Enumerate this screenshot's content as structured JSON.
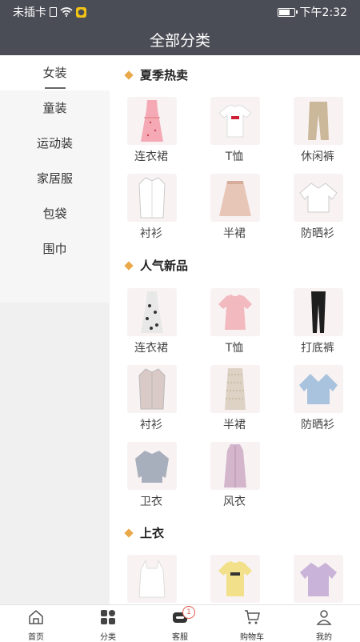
{
  "status": {
    "carrier": "未插卡",
    "time": "下午2:32"
  },
  "header": {
    "title": "全部分类"
  },
  "sidebar": {
    "items": [
      {
        "label": "女装",
        "active": true
      },
      {
        "label": "童装"
      },
      {
        "label": "运动装"
      },
      {
        "label": "家居服"
      },
      {
        "label": "包袋"
      },
      {
        "label": "围巾"
      }
    ]
  },
  "sections": [
    {
      "title": "夏季热卖",
      "items": [
        {
          "label": "连衣裙",
          "icon": "dress-icon"
        },
        {
          "label": "T恤",
          "icon": "tshirt-icon"
        },
        {
          "label": "休闲裤",
          "icon": "pants-icon"
        },
        {
          "label": "衬衫",
          "icon": "shirt-icon"
        },
        {
          "label": "半裙",
          "icon": "skirt-icon"
        },
        {
          "label": "防晒衫",
          "icon": "cardigan-icon"
        }
      ]
    },
    {
      "title": "人气新品",
      "items": [
        {
          "label": "连衣裙",
          "icon": "dress-icon"
        },
        {
          "label": "T恤",
          "icon": "tshirt-icon"
        },
        {
          "label": "打底裤",
          "icon": "leggings-icon"
        },
        {
          "label": "衬衫",
          "icon": "shirt-icon"
        },
        {
          "label": "半裙",
          "icon": "skirt-icon"
        },
        {
          "label": "防晒衫",
          "icon": "cardigan-icon"
        },
        {
          "label": "卫衣",
          "icon": "sweater-icon"
        },
        {
          "label": "风衣",
          "icon": "trenchcoat-icon"
        }
      ]
    },
    {
      "title": "上衣",
      "items": [
        {
          "label": "",
          "icon": "camisole-icon"
        },
        {
          "label": "",
          "icon": "tshirt-icon"
        },
        {
          "label": "",
          "icon": "cardigan-icon"
        }
      ]
    }
  ],
  "tabbar": {
    "items": [
      {
        "label": "首页",
        "icon": "home-icon"
      },
      {
        "label": "分类",
        "icon": "category-icon"
      },
      {
        "label": "客服",
        "icon": "service-icon",
        "badge": "1"
      },
      {
        "label": "购物车",
        "icon": "cart-icon"
      },
      {
        "label": "我的",
        "icon": "profile-icon"
      }
    ]
  },
  "colors": {
    "header_bg": "#4a4d55",
    "accent": "#e9a94a",
    "badge": "#e05a4e"
  }
}
